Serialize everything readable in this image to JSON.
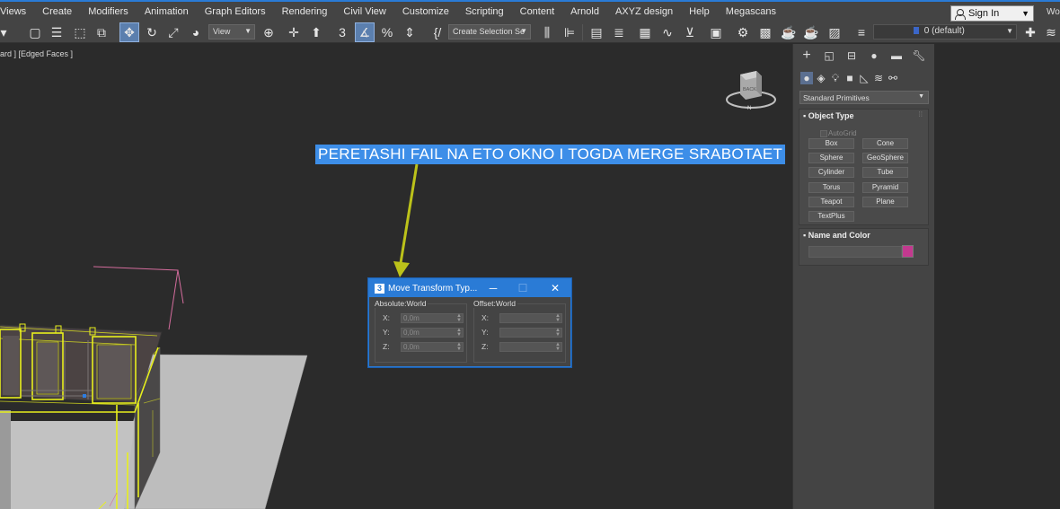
{
  "menu": [
    "Views",
    "Create",
    "Modifiers",
    "Animation",
    "Graph Editors",
    "Rendering",
    "Civil View",
    "Customize",
    "Scripting",
    "Content",
    "Arnold",
    "AXYZ design",
    "Help",
    "Megascans"
  ],
  "account": {
    "signin_label": "Sign In",
    "workspace_prefix": "Wo"
  },
  "toolbar": {
    "view_dropdown": "View",
    "selection_set": "Create Selection Se",
    "layer": "0 (default)"
  },
  "viewport": {
    "label": "ard ] [Edged Faces ]",
    "viewcube_face": "BACK",
    "compass_dir": "N",
    "note": "PERETASHI FAIL NA ETO OKNO I TOGDA MERGE SRABOTAET"
  },
  "colors": {
    "accent": "#2a7bd6",
    "note_bg": "#3d8ee8",
    "arrow": "#bcc21a",
    "object_color": "#c3398f",
    "frame_yellow": "#e8ef1d"
  },
  "dialog": {
    "icon": "3",
    "title": "Move Transform Typ...",
    "absolute": {
      "header": "Absolute:World",
      "fields": [
        {
          "label": "X:",
          "value": "0,0m"
        },
        {
          "label": "Y:",
          "value": "0,0m"
        },
        {
          "label": "Z:",
          "value": "0,0m"
        }
      ]
    },
    "offset": {
      "header": "Offset:World",
      "fields": [
        {
          "label": "X:",
          "value": ""
        },
        {
          "label": "Y:",
          "value": ""
        },
        {
          "label": "Z:",
          "value": ""
        }
      ]
    }
  },
  "command_panel": {
    "primitives_dropdown": "Standard Primitives",
    "object_type": {
      "title": "Object Type",
      "autogrid": "AutoGrid",
      "buttons": [
        "Box",
        "Cone",
        "Sphere",
        "GeoSphere",
        "Cylinder",
        "Tube",
        "Torus",
        "Pyramid",
        "Teapot",
        "Plane",
        "TextPlus"
      ]
    },
    "name_and_color": {
      "title": "Name and Color"
    }
  }
}
